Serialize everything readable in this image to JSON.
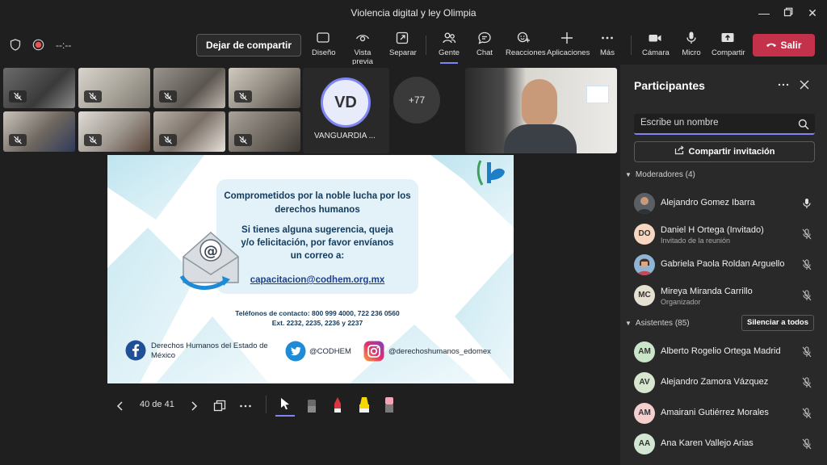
{
  "window": {
    "title": "Violencia digital y ley Olimpia"
  },
  "toolbar": {
    "timer": "--:--",
    "stop_sharing": "Dejar de compartir",
    "buttons": {
      "design": "Diseño",
      "preview": "Vista previa",
      "separate": "Separar",
      "people": "Gente",
      "chat": "Chat",
      "reactions": "Reacciones",
      "apps": "Aplicaciones",
      "more": "Más",
      "camera": "Cámara",
      "mic": "Micro",
      "share": "Compartir"
    },
    "leave": "Salir"
  },
  "gallery": {
    "vd_initials": "VD",
    "vd_name": "VANGUARDIA ...",
    "overflow": "+77"
  },
  "slide": {
    "heading_1": "Comprometidos por la noble lucha por los",
    "heading_2": "derechos humanos",
    "body_1": "Si tienes alguna sugerencia, queja",
    "body_2": "y/o felicitación, por favor envíanos",
    "body_3": "un correo a:",
    "email": "capacitacion@codhem.org.mx",
    "phones_1": "Teléfonos de contacto: 800 999 4000, 722 236 0560",
    "phones_2": "Ext. 2232, 2235, 2236 y 2237",
    "facebook_1": "Derechos Humanos del Estado de",
    "facebook_2": "México",
    "twitter": "@CODHEM",
    "instagram": "@derechoshumanos_edomex"
  },
  "presentation": {
    "page": "40 de 41"
  },
  "panel": {
    "title": "Participantes",
    "search_placeholder": "Escribe un nombre",
    "invite": "Compartir invitación",
    "moderators_label": "Moderadores (4)",
    "attendees_label": "Asistentes (85)",
    "mute_all": "Silenciar a todos",
    "moderators": [
      {
        "name": "Alejandro Gomez Ibarra",
        "initials": "",
        "sub": ""
      },
      {
        "name": "Daniel H Ortega (Invitado)",
        "initials": "DO",
        "sub": "Invitado de la reunión"
      },
      {
        "name": "Gabriela Paola Roldan Arguello",
        "initials": "",
        "sub": ""
      },
      {
        "name": "Mireya Miranda Carrillo",
        "initials": "MC",
        "sub": "Organizador"
      }
    ],
    "attendees": [
      {
        "name": "Alberto Rogelio Ortega Madrid",
        "initials": "AM"
      },
      {
        "name": "Alejandro Zamora Vázquez",
        "initials": "AV"
      },
      {
        "name": "Amairani Gutiérrez Morales",
        "initials": "AM"
      },
      {
        "name": "Ana Karen Vallejo Arias",
        "initials": "AA"
      }
    ]
  },
  "colors": {
    "accent": "#7f85f5",
    "leave": "#c4314b",
    "panel_bg": "#292929"
  }
}
